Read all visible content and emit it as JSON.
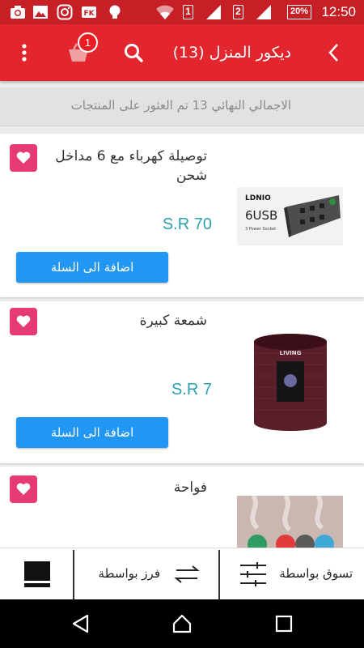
{
  "status_bar": {
    "time": "12:50",
    "battery": "20%",
    "sim1": "1",
    "sim2": "2"
  },
  "app_bar": {
    "title": "ديكور المنزل (13)",
    "cart_count": "1"
  },
  "summary": {
    "text": "الاجمالي النهائي 13 تم العثور على المنتجات"
  },
  "products": [
    {
      "name": "توصيلة كهرباء مع 6 مداخل شحن",
      "price": "S.R 70",
      "add_label": "اضافة الى السلة",
      "image_brand": "LDNIO",
      "image_text": "6USB",
      "image_sub": "3 Power Socket"
    },
    {
      "name": "شمعة كبيرة",
      "price": "S.R 7",
      "add_label": "اضافة الى السلة",
      "image_brand": "LIVING"
    },
    {
      "name": "فواحة"
    }
  ],
  "bottom_bar": {
    "shop_by": "تسوق بواسطة",
    "sort_by": "فرز بواسطة"
  },
  "colors": {
    "primary": "#e3262d",
    "status": "#c62026",
    "button": "#2196f3",
    "heart": "#e63a73",
    "price": "#2aa0b0"
  }
}
